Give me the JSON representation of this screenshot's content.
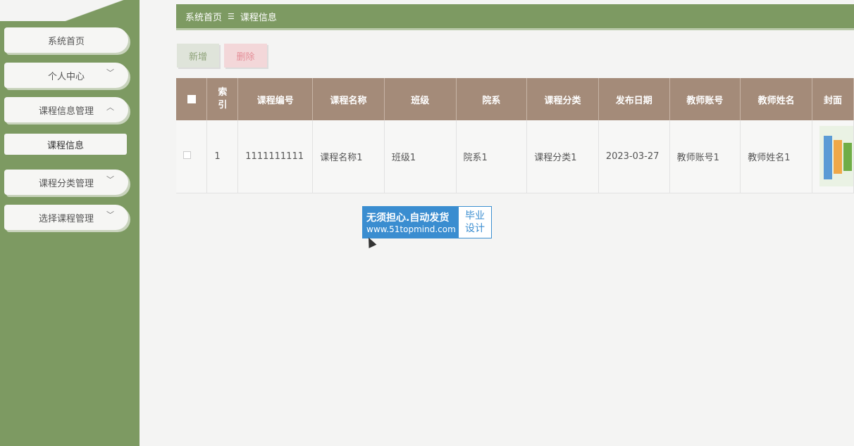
{
  "sidebar": {
    "items": [
      {
        "label": "系统首页",
        "chevron": ""
      },
      {
        "label": "个人中心",
        "chevron": "chevron-down"
      },
      {
        "label": "课程信息管理",
        "chevron": "chevron-up"
      },
      {
        "label": "课程分类管理",
        "chevron": "chevron-down"
      },
      {
        "label": "选择课程管理",
        "chevron": "chevron-down"
      }
    ],
    "sub_item": "课程信息"
  },
  "breadcrumb": {
    "home": "系统首页",
    "separator": "☰",
    "current": "课程信息"
  },
  "toolbar": {
    "add_label": "新增",
    "delete_label": "删除"
  },
  "table": {
    "headers": [
      "",
      "索引",
      "课程编号",
      "课程名称",
      "班级",
      "院系",
      "课程分类",
      "发布日期",
      "教师账号",
      "教师姓名",
      "封面"
    ],
    "rows": [
      [
        "",
        "1",
        "1111111111",
        "课程名称1",
        "班级1",
        "院系1",
        "课程分类1",
        "2023-03-27",
        "教师账号1",
        "教师姓名1",
        ""
      ]
    ]
  },
  "ad": {
    "line1": "无须担心.自动发货",
    "line2": "www.51topmind.com",
    "badge1": "毕业",
    "badge2": "设计"
  },
  "colors": {
    "sidebar": "#7d9a62",
    "table_header": "#a48b79",
    "add_button": "#dfe4da",
    "delete_button": "#f3d7d9"
  }
}
